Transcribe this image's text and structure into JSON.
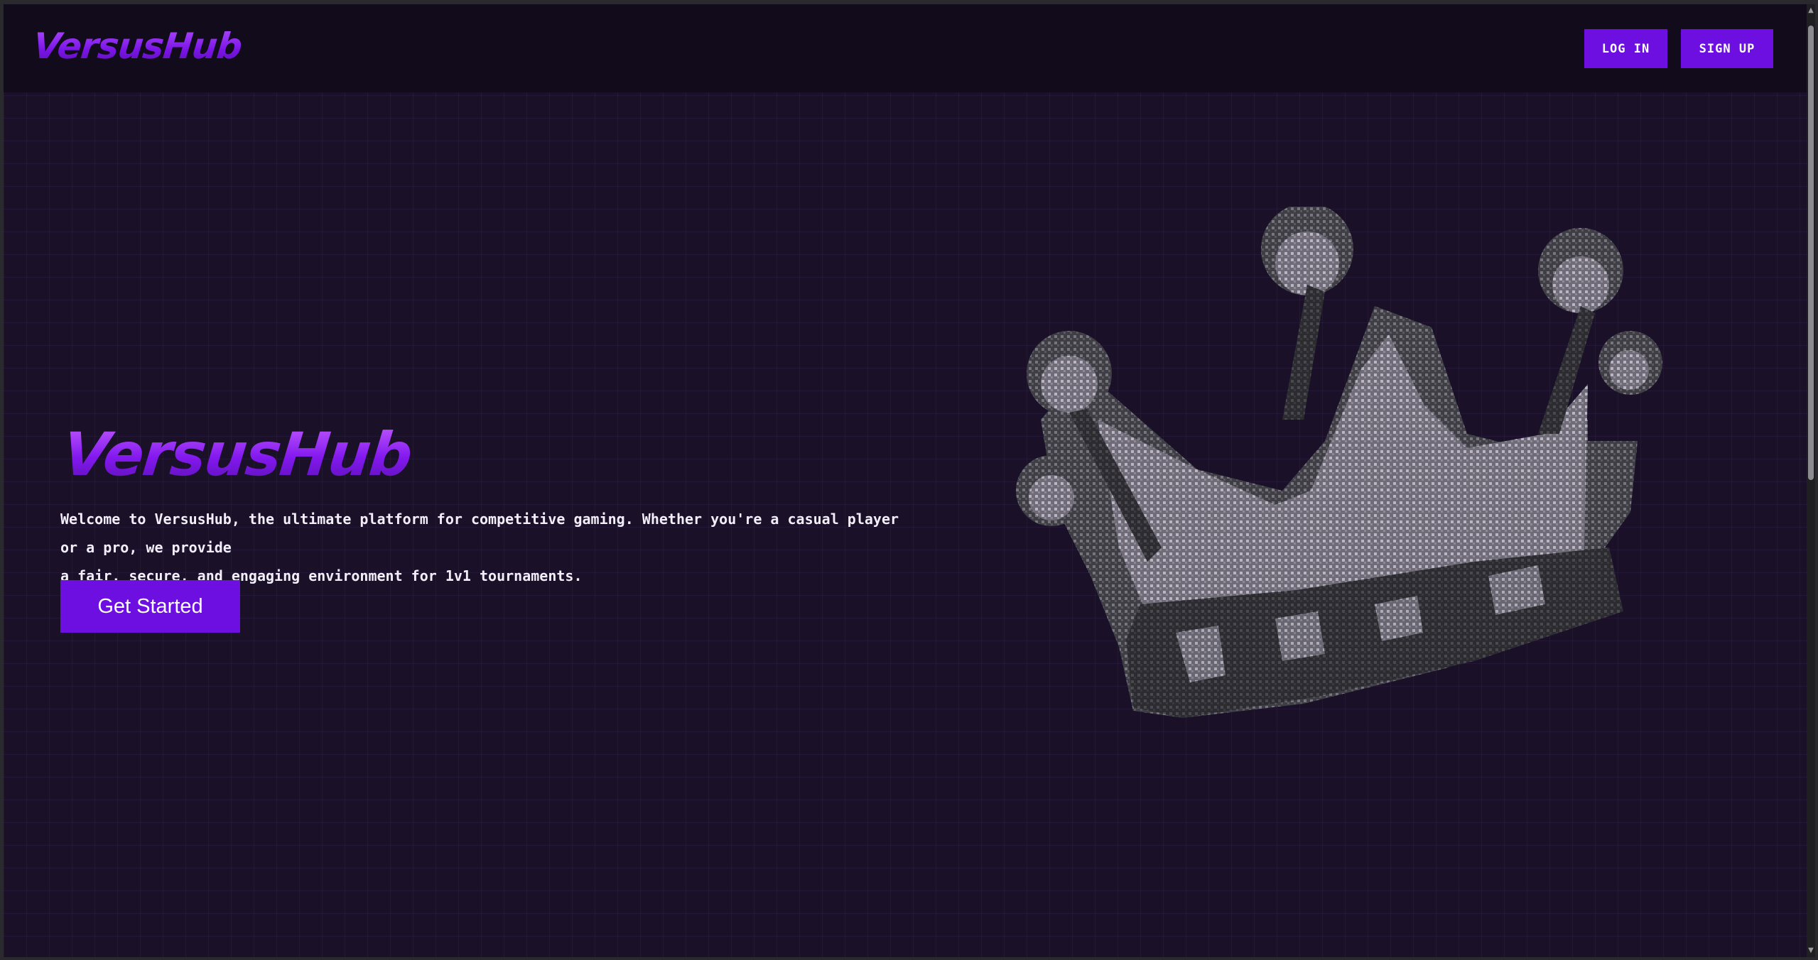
{
  "navbar": {
    "brand": "VersusHub",
    "login_label": "LOG IN",
    "signup_label": "SIGN UP"
  },
  "hero": {
    "title": "VersusHub",
    "description_line1": "Welcome to VersusHub, the ultimate platform for competitive gaming. Whether you're a casual player or a pro, we provide",
    "description_line2": "a fair, secure, and engaging environment for 1v1 tournaments.",
    "cta_label": "Get Started"
  },
  "illustration": {
    "icon": "crown-icon"
  },
  "colors": {
    "accent": "#6d0fe0",
    "brand_gradient_top": "#b04dff",
    "background": "#1a1128",
    "navbar": "#110b1c"
  }
}
